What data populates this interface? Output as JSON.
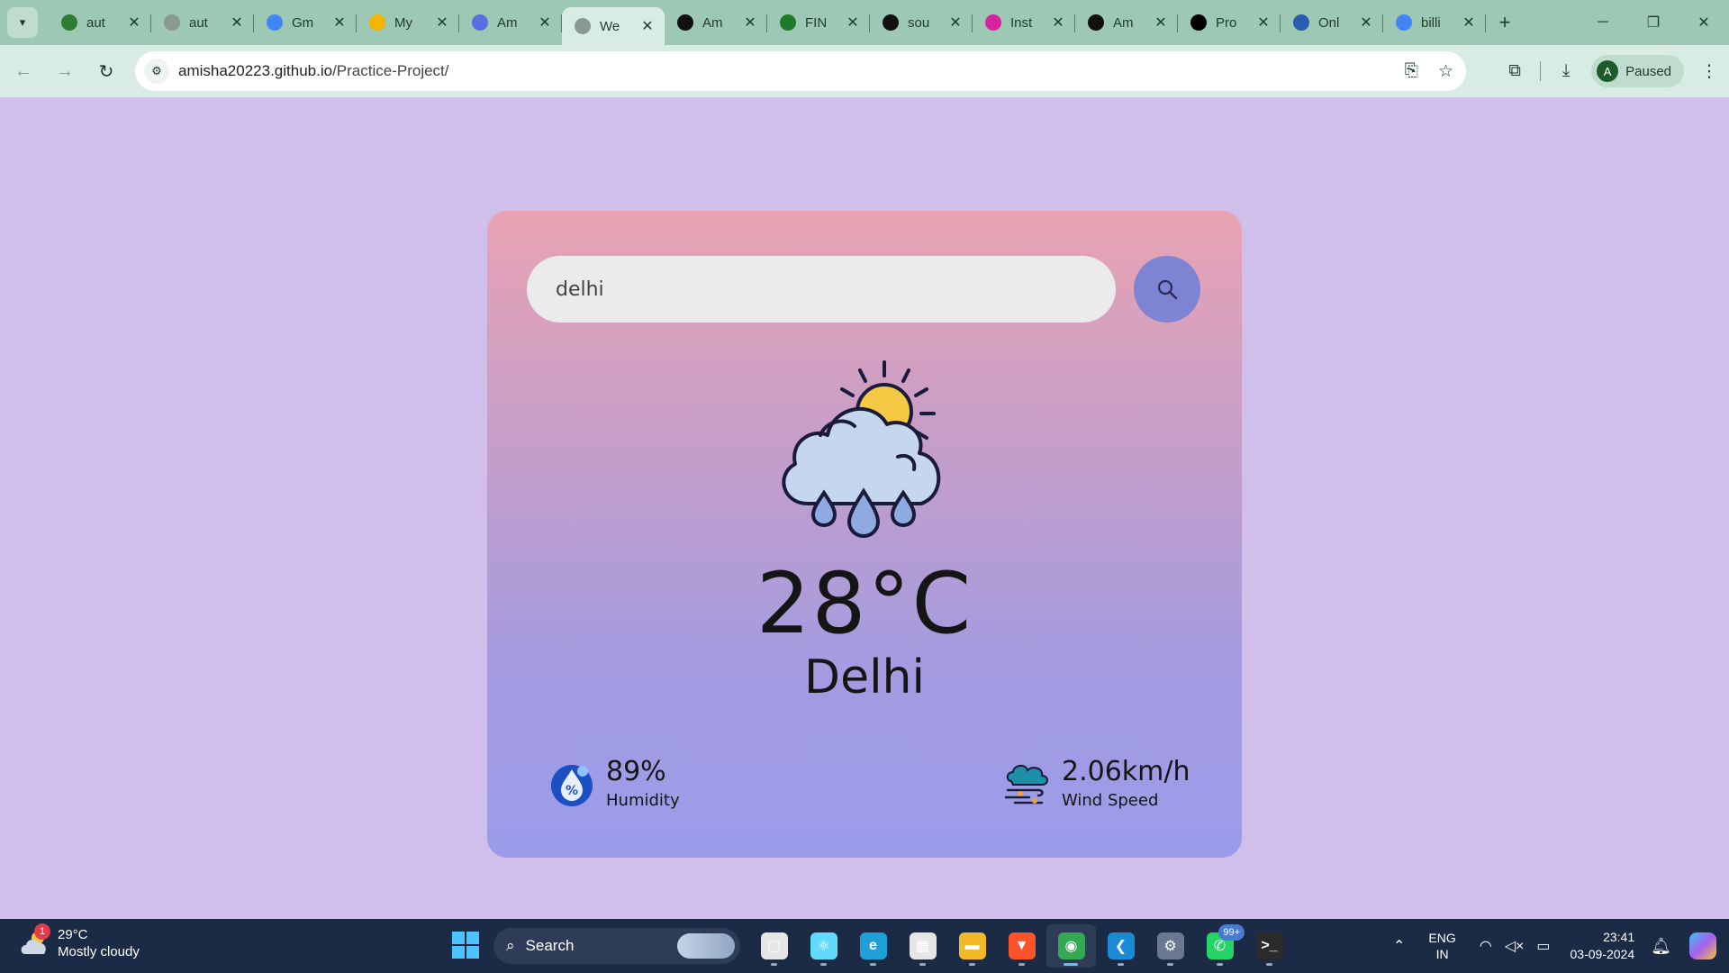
{
  "browser": {
    "tabs": [
      {
        "title": "aut",
        "favicon": "leaf-icon",
        "color": "#2e7d32",
        "active": false
      },
      {
        "title": "aut",
        "favicon": "globe-icon",
        "color": "#8a9a93",
        "active": false
      },
      {
        "title": "Gm",
        "favicon": "google-icon",
        "color": "#4285f4",
        "active": false
      },
      {
        "title": "My",
        "favicon": "google-drive-icon",
        "color": "#f4b400",
        "active": false
      },
      {
        "title": "Am",
        "favicon": "gear-flower-icon",
        "color": "#5b6ee1",
        "active": false
      },
      {
        "title": "We",
        "favicon": "globe-icon",
        "color": "#8a9a93",
        "active": true
      },
      {
        "title": "Am",
        "favicon": "github-icon",
        "color": "#111111",
        "active": false
      },
      {
        "title": "FIN",
        "favicon": "document-icon",
        "color": "#1f7a2a",
        "active": false
      },
      {
        "title": "sou",
        "favicon": "github-icon",
        "color": "#111111",
        "active": false
      },
      {
        "title": "Inst",
        "favicon": "instagram-icon",
        "color": "#d6249f",
        "active": false
      },
      {
        "title": "Am",
        "favicon": "github-icon",
        "color": "#111111",
        "active": false
      },
      {
        "title": "Pro",
        "favicon": "x-icon",
        "color": "#000000",
        "active": false
      },
      {
        "title": "Onl",
        "favicon": "s-icon",
        "color": "#2a5db0",
        "active": false
      },
      {
        "title": "billi",
        "favicon": "google-icon",
        "color": "#4285f4",
        "active": false
      }
    ],
    "address": {
      "domain": "amisha20223.github.io",
      "path": "/Practice-Project/"
    },
    "profile_initial": "A",
    "profile_label": "Paused"
  },
  "weather": {
    "search_value": "delhi",
    "temperature": "28°C",
    "city": "Delhi",
    "humidity_value": "89%",
    "humidity_label": "Humidity",
    "wind_value": "2.06km/h",
    "wind_label": "Wind Speed",
    "icon": "cloud-sun-rain-icon"
  },
  "taskbar": {
    "weather_temp": "29°C",
    "weather_desc": "Mostly cloudy",
    "weather_badge": "1",
    "search_label": "Search",
    "apps": [
      {
        "name": "task-view-icon",
        "color": "#e6e6e6",
        "glyph": "▢",
        "active": false
      },
      {
        "name": "react-icon",
        "color": "#61dafb",
        "glyph": "⚛",
        "active": false
      },
      {
        "name": "edge-icon",
        "color": "#1fa0d8",
        "glyph": "e",
        "active": false
      },
      {
        "name": "store-icon",
        "color": "#e6e6e6",
        "glyph": "▦",
        "active": false
      },
      {
        "name": "file-explorer-icon",
        "color": "#f2b827",
        "glyph": "▬",
        "active": false
      },
      {
        "name": "brave-icon",
        "color": "#fb542b",
        "glyph": "▼",
        "active": false
      },
      {
        "name": "chrome-icon",
        "color": "#34a853",
        "glyph": "◉",
        "active": true
      },
      {
        "name": "vscode-icon",
        "color": "#1a8ad4",
        "glyph": "❮",
        "active": false
      },
      {
        "name": "settings-icon",
        "color": "#6b7890",
        "glyph": "⚙",
        "active": false
      },
      {
        "name": "whatsapp-icon",
        "color": "#25d366",
        "glyph": "✆",
        "active": false,
        "badge": "99+"
      },
      {
        "name": "terminal-icon",
        "color": "#2b2b2b",
        "glyph": ">_",
        "active": false
      }
    ],
    "lang_line1": "ENG",
    "lang_line2": "IN",
    "time": "23:41",
    "date": "03-09-2024"
  }
}
